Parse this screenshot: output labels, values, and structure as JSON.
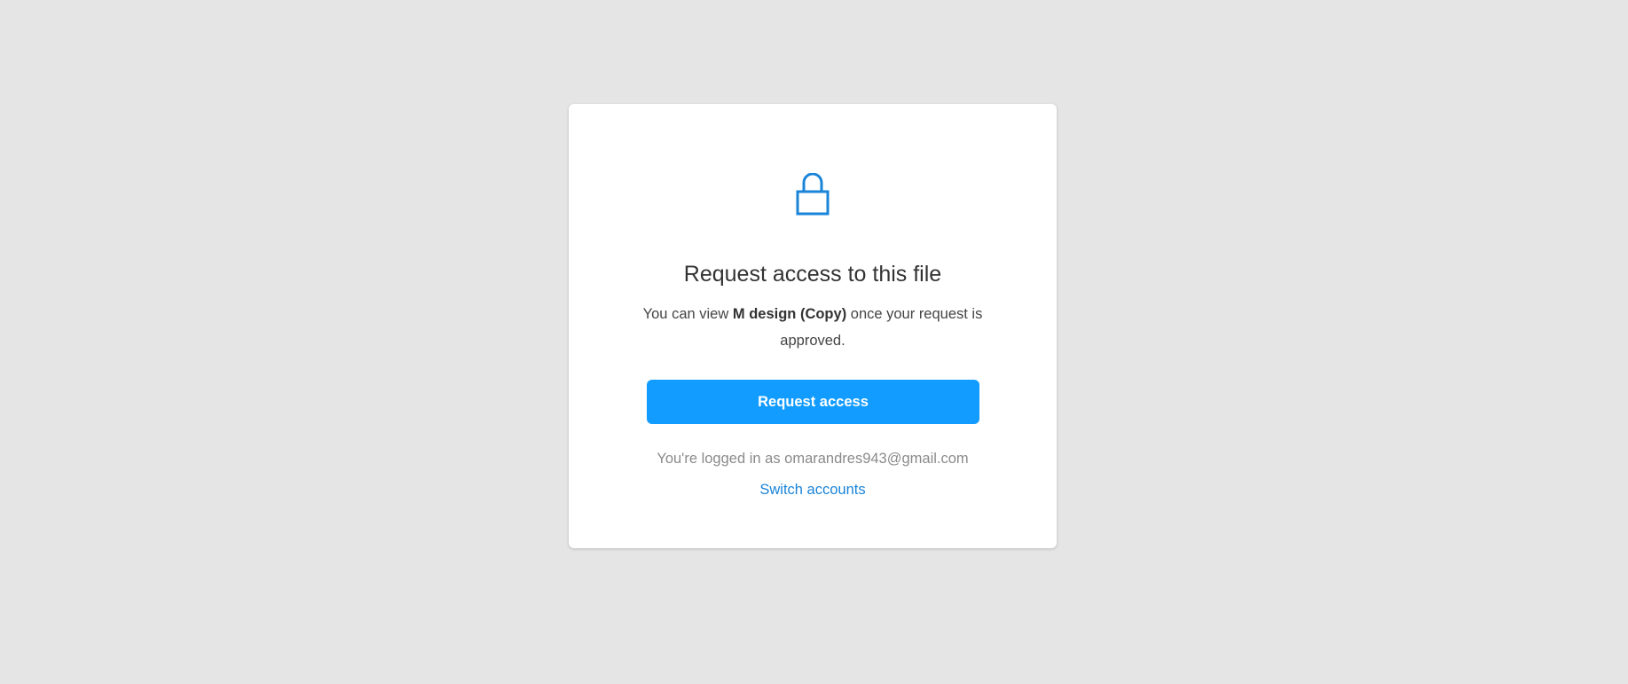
{
  "dialog": {
    "icon": "lock-icon",
    "title": "Request access to this file",
    "description_prefix": "You can view ",
    "file_name": "M design (Copy)",
    "description_suffix": " once your request is approved.",
    "button_label": "Request access",
    "logged_in_text": "You're logged in as omarandres943@gmail.com",
    "switch_label": "Switch accounts"
  },
  "colors": {
    "background": "#e5e5e5",
    "accent": "#129cff",
    "link": "#1a84d8",
    "icon": "#1a84d8"
  }
}
